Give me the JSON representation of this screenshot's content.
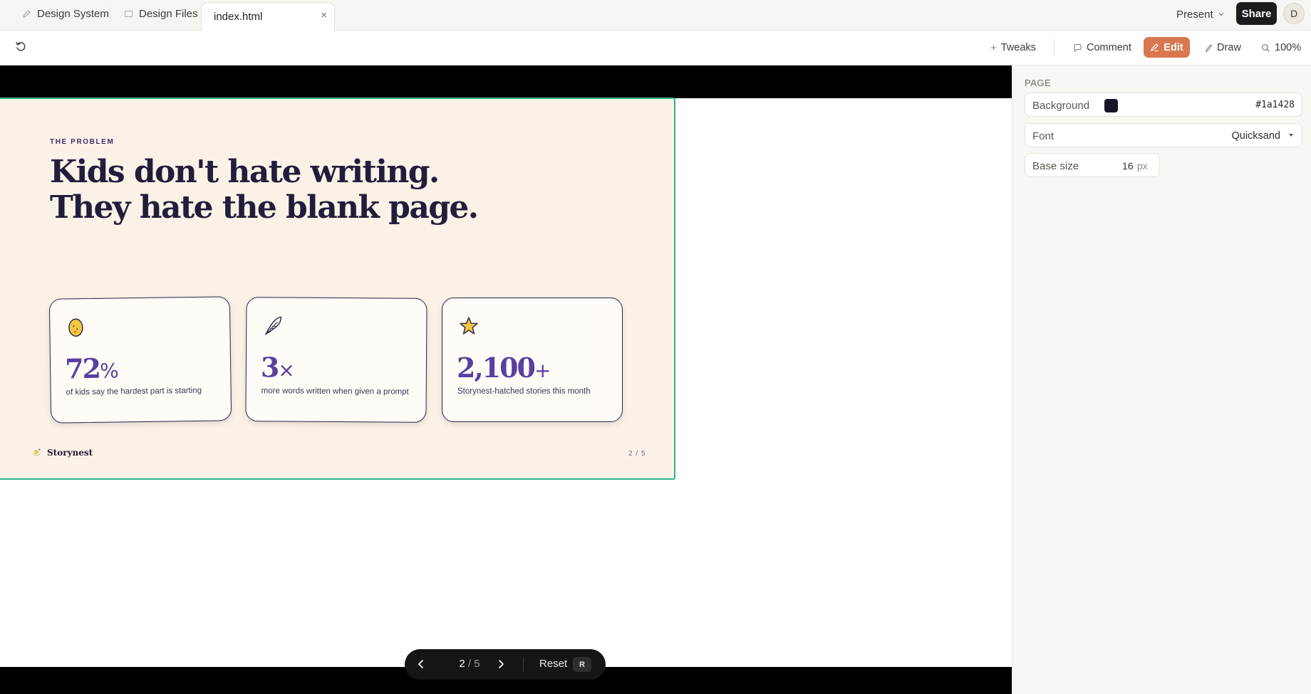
{
  "tabs": {
    "design_system": "Design System",
    "design_files": "Design Files",
    "active": "index.html",
    "close": "×"
  },
  "topbar": {
    "present": "Present",
    "share": "Share",
    "avatar": "D"
  },
  "toolbar": {
    "tweaks": "Tweaks",
    "comment": "Comment",
    "edit": "Edit",
    "draw": "Draw",
    "zoom": "100%"
  },
  "slide": {
    "eyebrow": "THE PROBLEM",
    "headline": "Kids don't hate writing. They hate the blank page.",
    "stats": [
      {
        "value": "72",
        "suffix": "%",
        "desc": "of kids say the hardest part is starting",
        "icon": "egg-icon"
      },
      {
        "value": "3",
        "suffix": "×",
        "desc": "more words written when given a prompt",
        "icon": "feather-icon"
      },
      {
        "value": "2,100",
        "suffix": "+",
        "desc": "Storynest-hatched stories this month",
        "icon": "star-icon"
      }
    ],
    "brand": "Storynest",
    "page_label": "2 / 5"
  },
  "nav": {
    "current": "2",
    "total": "/ 5",
    "reset": "Reset",
    "shortcut": "R"
  },
  "panel": {
    "section": "PAGE",
    "background_label": "Background",
    "background_value": "#1a1428",
    "font_label": "Font",
    "font_value": "Quicksand",
    "base_size_label": "Base size",
    "base_size_value": "16",
    "base_size_unit": "px"
  },
  "colors": {
    "accent": "#d9784f",
    "slide_bg": "#faf2e7",
    "selection": "#2fb58a",
    "stat_purple": "#5a3ea0",
    "ink": "#231d3c"
  }
}
